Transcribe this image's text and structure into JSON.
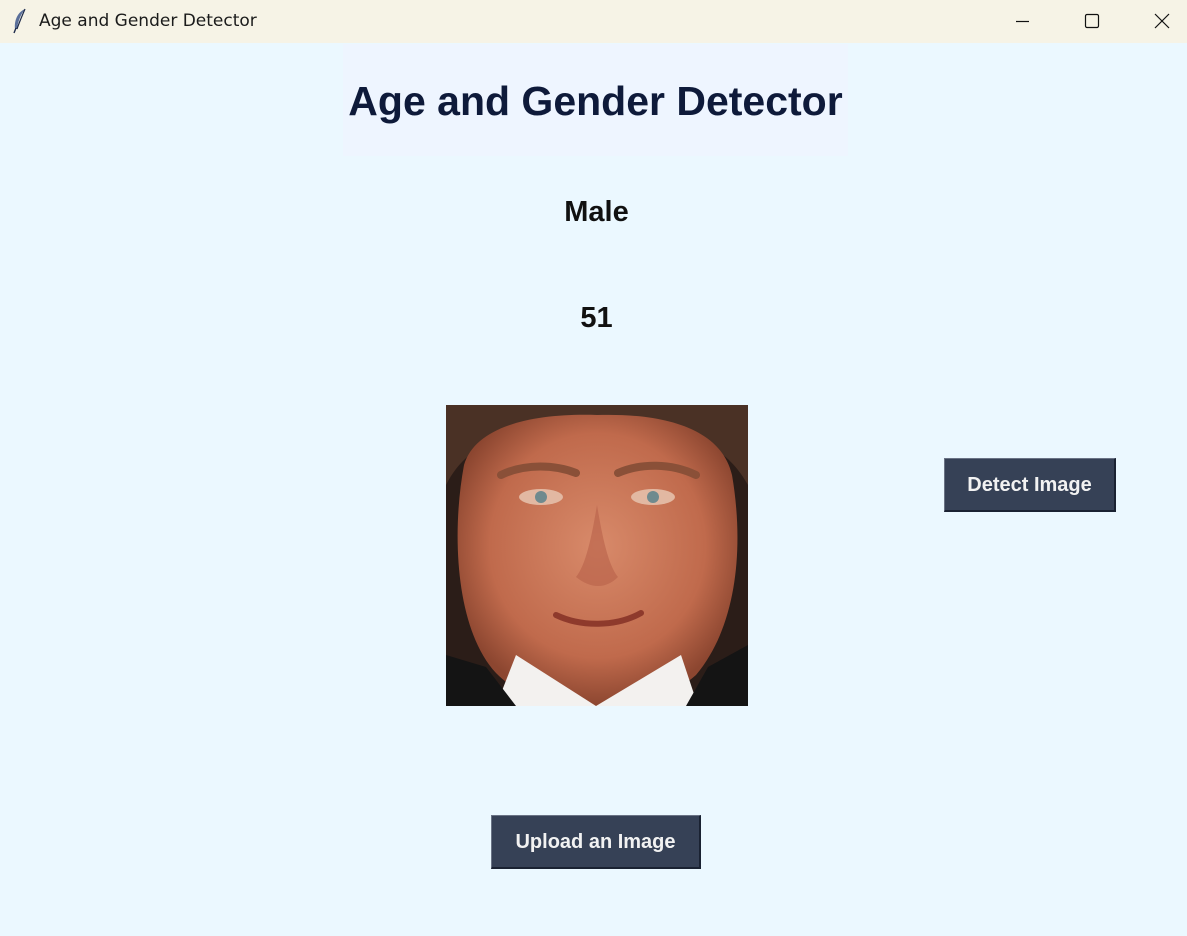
{
  "window": {
    "title": "Age and Gender Detector",
    "icon": "feather-icon",
    "controls": [
      "minimize-icon",
      "maximize-icon",
      "close-icon"
    ]
  },
  "main": {
    "heading": "Age and Gender Detector",
    "gender_result": "Male",
    "age_result": "51",
    "photo": "face-photo",
    "detect_button_label": "Detect Image",
    "upload_button_label": "Upload an Image"
  },
  "colors": {
    "background": "#ebf8ff",
    "titlebar": "#f6f3e6",
    "heading_box": "#eef5ff",
    "heading_text": "#0e1a3a",
    "button_bg": "#364156",
    "button_text": "#f2f2f2"
  }
}
